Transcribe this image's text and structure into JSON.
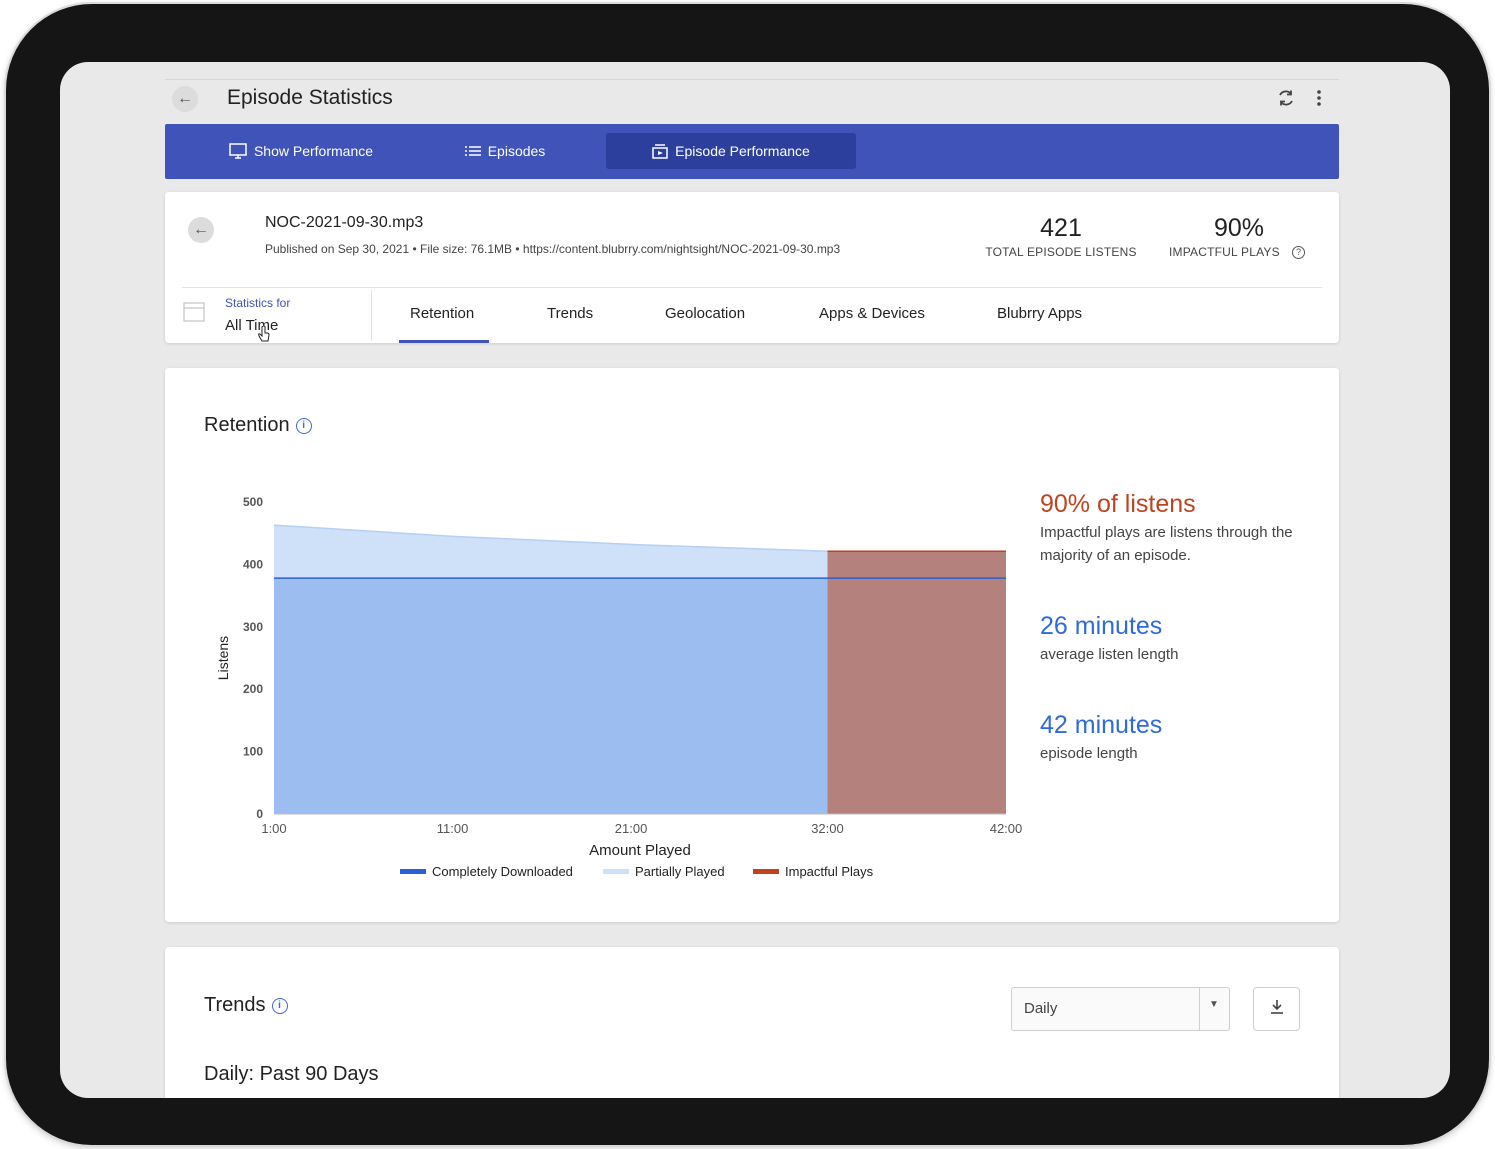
{
  "header": {
    "title": "Episode Statistics"
  },
  "nav": {
    "tabs": [
      {
        "label": "Show Performance",
        "icon": "monitor-icon"
      },
      {
        "label": "Episodes",
        "icon": "list-icon"
      },
      {
        "label": "Episode Performance",
        "icon": "podcast-icon"
      }
    ],
    "active": "Episode Performance"
  },
  "episode": {
    "filename": "NOC-2021-09-30.mp3",
    "meta": "Published on Sep 30, 2021 • File size: 76.1MB • https://content.blubrry.com/nightsight/NOC-2021-09-30.mp3",
    "total_listens": "421",
    "total_listens_label": "TOTAL EPISODE LISTENS",
    "impactful_plays": "90%",
    "impactful_plays_label": "IMPACTFUL PLAYS"
  },
  "filter": {
    "label": "Statistics for",
    "value": "All Time"
  },
  "subtabs": [
    "Retention",
    "Trends",
    "Geolocation",
    "Apps & Devices",
    "Blubrry Apps"
  ],
  "active_subtab": "Retention",
  "retention": {
    "title": "Retention",
    "insights": [
      {
        "big": "90% of listens",
        "small": "Impactful plays are listens through the majority of an episode.",
        "color": "#c0431f"
      },
      {
        "big": "26 minutes",
        "small": "average listen length",
        "color": "#2f6bd8"
      },
      {
        "big": "42 minutes",
        "small": "episode length",
        "color": "#2f6bd8"
      }
    ]
  },
  "trends": {
    "title": "Trends",
    "dropdown_value": "Daily",
    "subheading": "Daily: Past 90 Days"
  },
  "colors": {
    "nav": "#3f53b8",
    "completely_downloaded": "#9bbdf0",
    "completely_downloaded_line": "#2c5fd4",
    "partially_played": "#cfe0f9",
    "impactful_plays": "#b5817c",
    "impactful_plays_line": "#c0431f"
  },
  "chart_data": {
    "type": "area",
    "xlabel": "Amount Played",
    "ylabel": "Listens",
    "ylim": [
      0,
      500
    ],
    "yticks": [
      0,
      100,
      200,
      300,
      400,
      500
    ],
    "xticks": [
      "1:00",
      "11:00",
      "21:00",
      "32:00",
      "42:00"
    ],
    "x_minutes": [
      1,
      11,
      21,
      32,
      42
    ],
    "legend_position": "bottom",
    "grid": false,
    "series": [
      {
        "name": "Completely Downloaded",
        "x": [
          1,
          32
        ],
        "values": [
          378,
          378
        ]
      },
      {
        "name": "Partially Played",
        "x": [
          1,
          11,
          21,
          32
        ],
        "values": [
          463,
          445,
          432,
          421
        ]
      },
      {
        "name": "Impactful Plays",
        "x": [
          32,
          42
        ],
        "values": [
          421,
          421
        ]
      }
    ]
  }
}
